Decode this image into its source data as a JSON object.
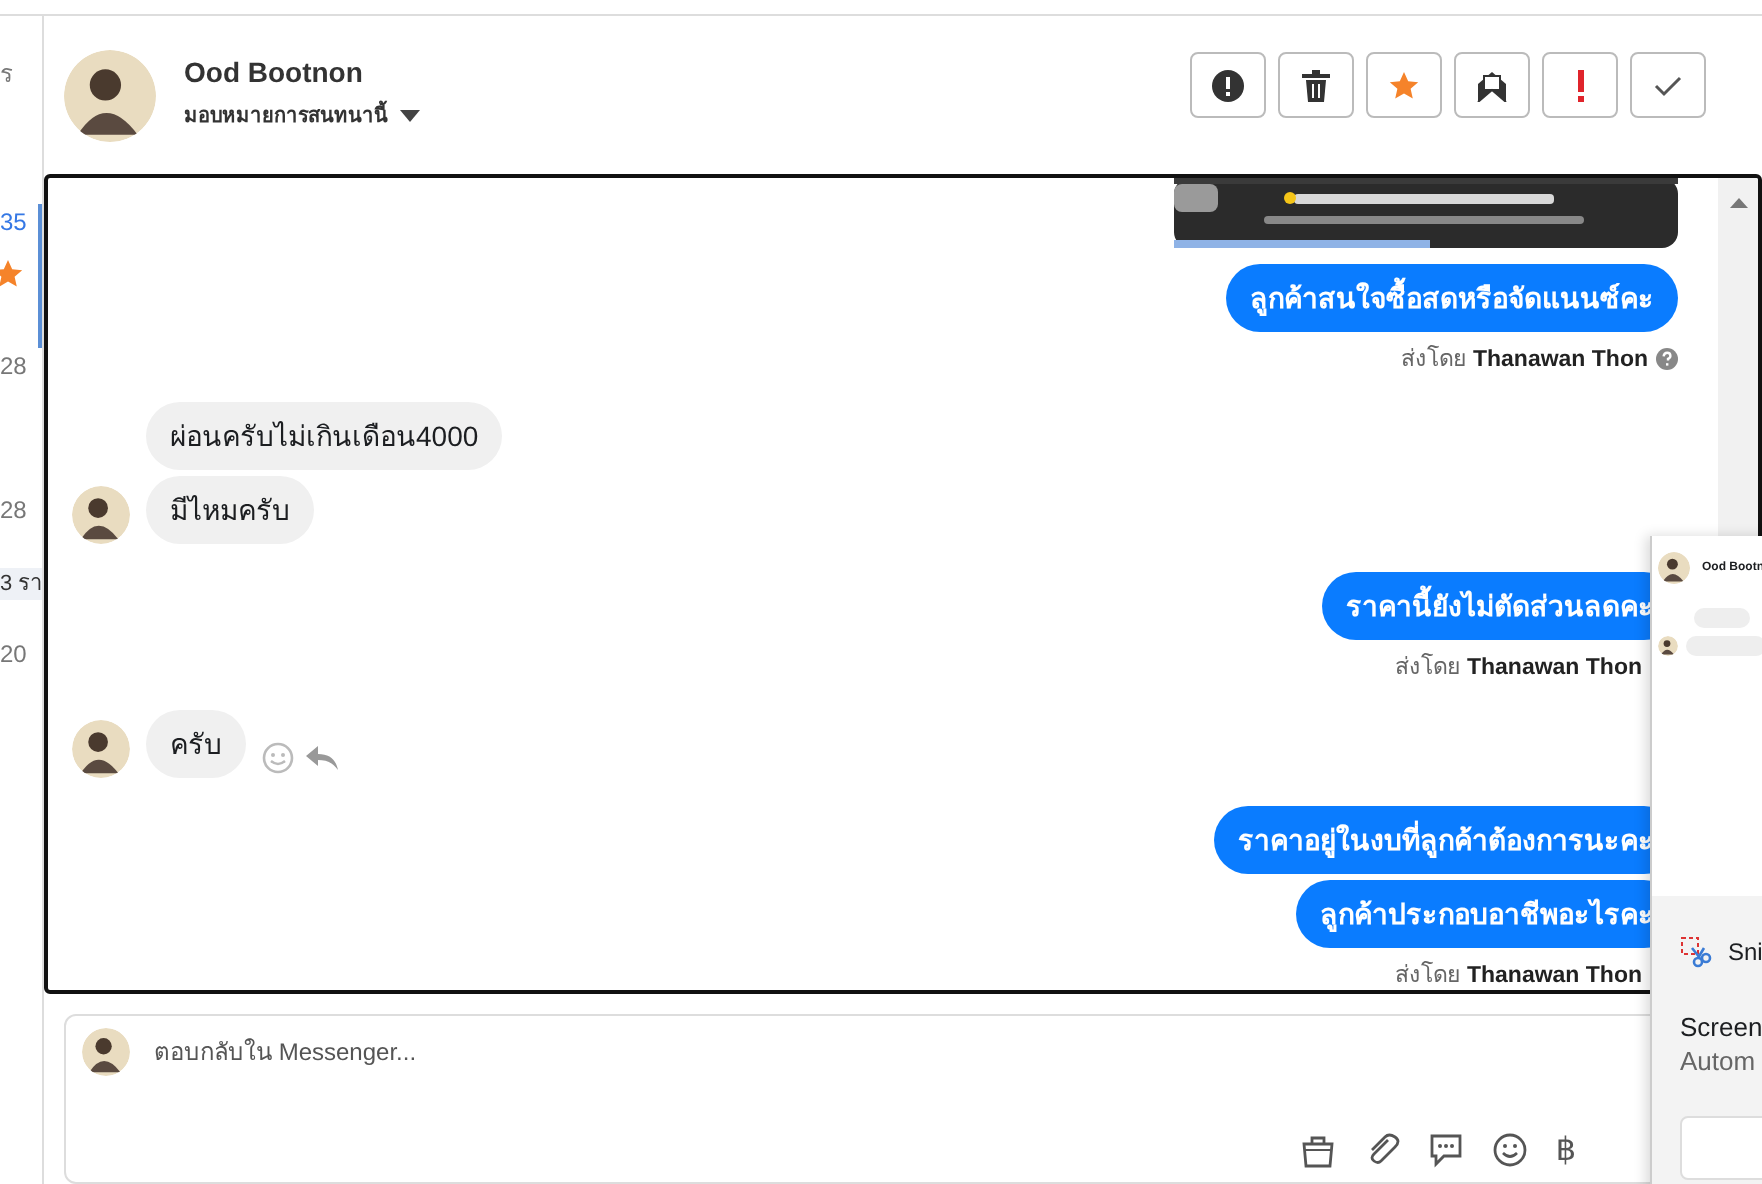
{
  "sidebar": {
    "items": [
      {
        "text": "ร",
        "selected": false,
        "starred": false,
        "highlighted": false
      },
      {
        "text": "35",
        "selected": true,
        "starred": true,
        "highlighted": false
      },
      {
        "text": "28",
        "selected": false,
        "starred": false,
        "highlighted": false
      },
      {
        "text": "28",
        "selected": false,
        "starred": false,
        "highlighted": false
      },
      {
        "text": "3 รา",
        "selected": false,
        "starred": false,
        "highlighted": true
      },
      {
        "text": "20",
        "selected": false,
        "starred": false,
        "highlighted": false
      }
    ]
  },
  "header": {
    "name": "Ood Bootnon",
    "assign_label": "มอบหมายการสนทนานี้",
    "actions": [
      {
        "kind": "alert"
      },
      {
        "kind": "trash"
      },
      {
        "kind": "star"
      },
      {
        "kind": "mail"
      },
      {
        "kind": "important"
      },
      {
        "kind": "check"
      }
    ]
  },
  "messages": [
    {
      "kind": "picture"
    },
    {
      "kind": "out",
      "text": "ลูกค้าสนใจซื้อสดหรือจัดแนนซ์คะ"
    },
    {
      "kind": "sent_by",
      "label": "ส่งโดย",
      "name": "Thanawan Thon",
      "help_icon": true
    },
    {
      "kind": "in",
      "text": "ผ่อนครับไม่เกินเดือน4000",
      "avatar": false,
      "actions": false
    },
    {
      "kind": "in",
      "text": "มีไหมครับ",
      "avatar": true,
      "actions": false
    },
    {
      "kind": "out",
      "text": "ราคานี้ยังไม่ตัดส่วนลดคะ"
    },
    {
      "kind": "sent_by",
      "label": "ส่งโดย",
      "name": "Thanawan Thon",
      "help_icon": false
    },
    {
      "kind": "in",
      "text": "ครับ",
      "avatar": true,
      "actions": true
    },
    {
      "kind": "out",
      "text": "ราคาอยู่ในงบที่ลูกค้าต้องการนะคะ"
    },
    {
      "kind": "out",
      "text": "ลูกค้าประกอบอาชีพอะไรคะ"
    },
    {
      "kind": "sent_by",
      "label": "ส่งโดย",
      "name": "Thanawan Thon",
      "help_icon": false
    }
  ],
  "composer": {
    "placeholder": "ตอบกลับใน Messenger...",
    "tools": [
      {
        "kind": "bag"
      },
      {
        "kind": "clip"
      },
      {
        "kind": "chat"
      },
      {
        "kind": "smiley"
      },
      {
        "kind": "text",
        "text": "฿"
      }
    ]
  },
  "notification": {
    "preview_name": "Ood Bootn",
    "app": "Sni",
    "title": "Screen",
    "subtitle": "Autom"
  }
}
